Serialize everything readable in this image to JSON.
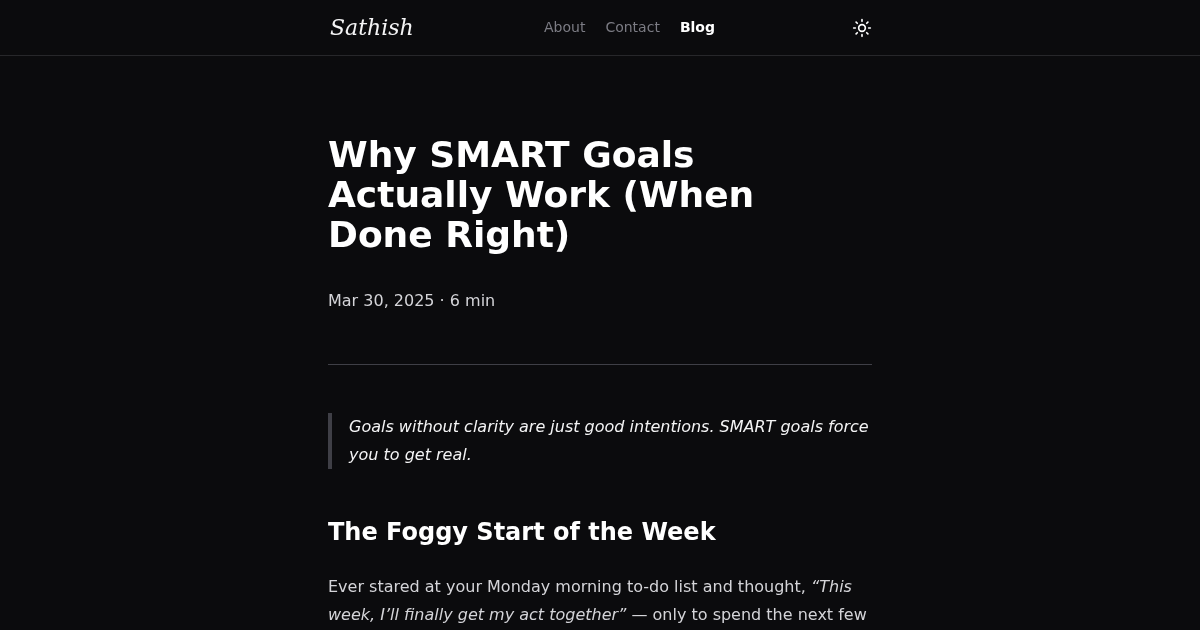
{
  "header": {
    "logo": "Sathish",
    "nav": [
      {
        "label": "About",
        "selected": false
      },
      {
        "label": "Contact",
        "selected": false
      },
      {
        "label": "Blog",
        "selected": true
      }
    ]
  },
  "article": {
    "title": "Why SMART Goals Actually Work (When Done Right)",
    "meta": "Mar 30, 2025 · 6 min",
    "quote": "Goals without clarity are just good intentions. SMART goals force you to get real.",
    "heading": "The Foggy Start of the Week",
    "paragraph": "Ever stared at your Monday morning to-do list and thought, *“This week, I’ll finally get my act together”* — only to spend the next few"
  }
}
